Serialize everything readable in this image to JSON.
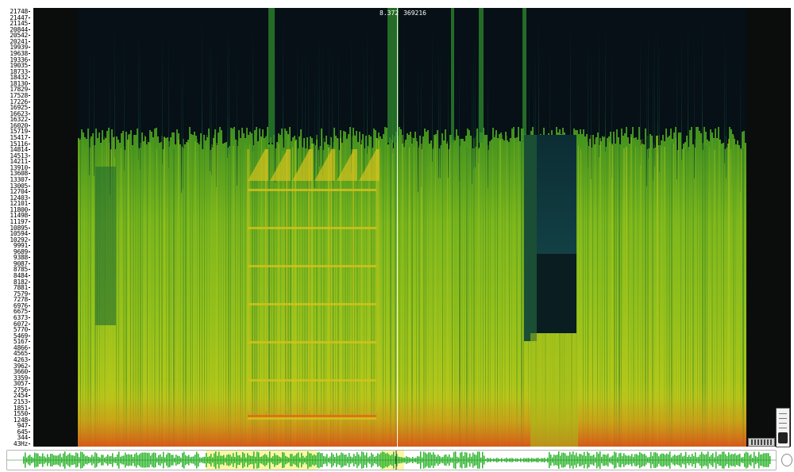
{
  "frequency_axis": {
    "labels": [
      "21748",
      "21447",
      "21145",
      "20844",
      "20542",
      "20241",
      "19939",
      "19638",
      "19336",
      "19035",
      "18733",
      "18432",
      "18130",
      "17829",
      "17528",
      "17226",
      "16925",
      "16623",
      "16322",
      "16020",
      "15719",
      "15417",
      "15116",
      "14814",
      "14513",
      "14211",
      "13910",
      "13608",
      "13307",
      "13005",
      "12704",
      "12403",
      "12101",
      "11800",
      "11498",
      "11197",
      "10895",
      "10594",
      "10292",
      "9991",
      "9689",
      "9388",
      "9087",
      "8785",
      "8484",
      "8182",
      "7881",
      "7579",
      "7278",
      "6976",
      "6675",
      "6373",
      "6072",
      "5770",
      "5469",
      "5167",
      "4866",
      "4565",
      "4263",
      "3962",
      "3660",
      "3359",
      "3057",
      "2756",
      "2454",
      "2153",
      "1851",
      "1550",
      "1248",
      "947",
      "645",
      "344",
      "43Hz"
    ]
  },
  "cursor_readout": {
    "time": "8.372",
    "frequency": "369216"
  },
  "colors": {
    "background_dark": "#050d10",
    "spectral_green": "#4c9a23",
    "spectral_yellow": "#c8d21b",
    "spectral_orange": "#d98a18",
    "waveform_green": "#2bb52b"
  },
  "icons": {
    "zoom": "zoom-slider-icon",
    "scroll": "scroll-indicator-icon"
  }
}
